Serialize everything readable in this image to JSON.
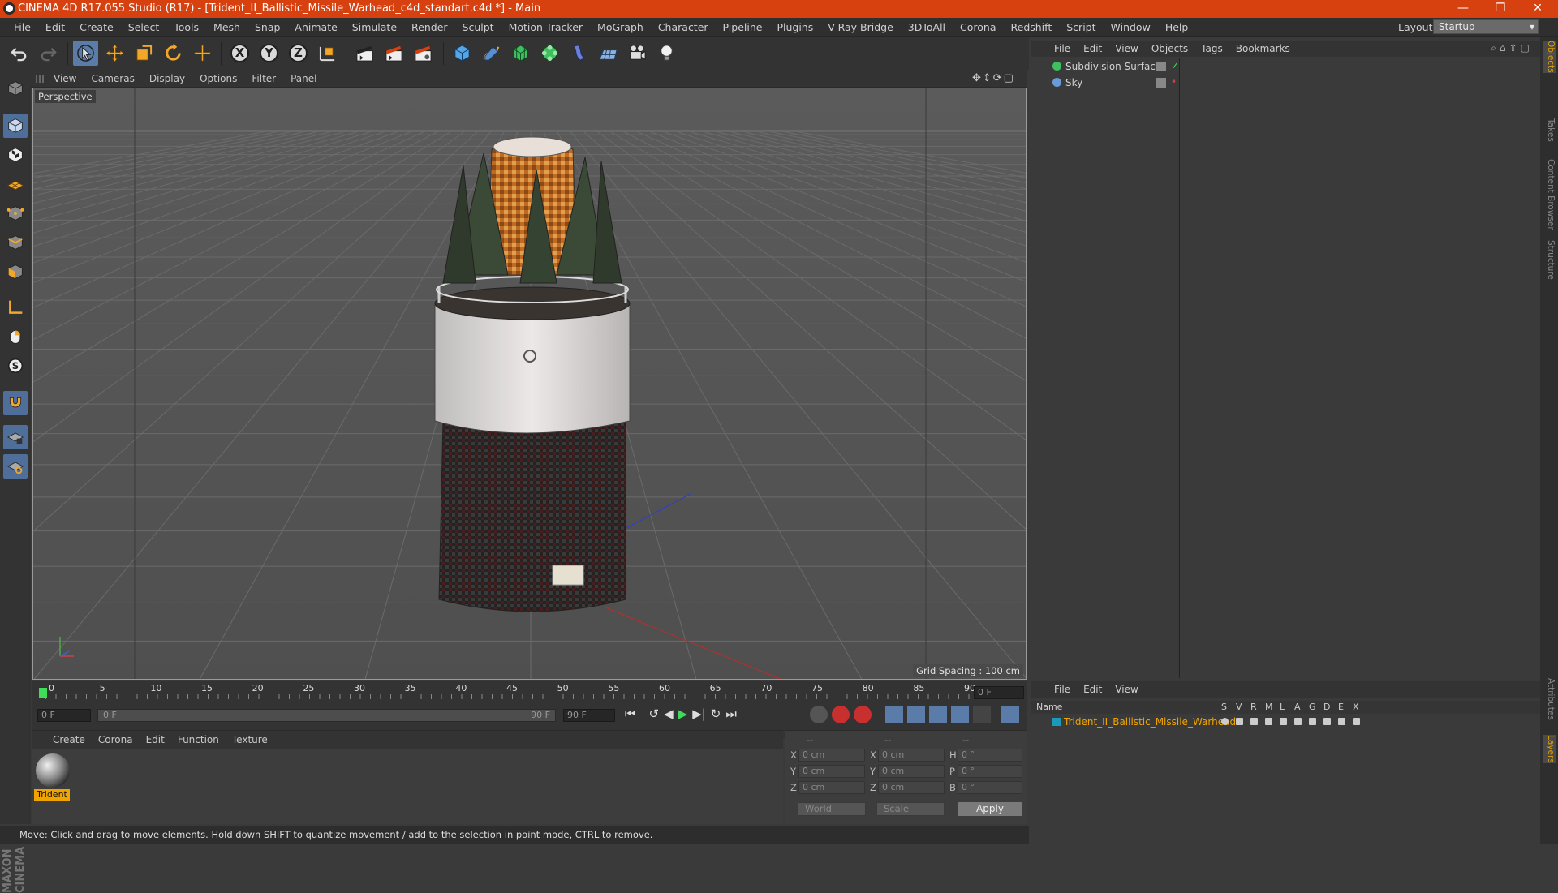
{
  "window": {
    "title": "CINEMA 4D R17.055 Studio (R17) - [Trident_II_Ballistic_Missile_Warhead_c4d_standart.c4d *] - Main",
    "minimize": "—",
    "maximize": "❐",
    "close": "✕"
  },
  "menubar": {
    "items": [
      "File",
      "Edit",
      "Create",
      "Select",
      "Tools",
      "Mesh",
      "Snap",
      "Animate",
      "Simulate",
      "Render",
      "Sculpt",
      "Motion Tracker",
      "MoGraph",
      "Character",
      "Pipeline",
      "Plugins",
      "V-Ray Bridge",
      "3DToAll",
      "Corona",
      "Redshift",
      "Script",
      "Window",
      "Help"
    ],
    "layout_label": "Layout:",
    "layout_value": "Startup"
  },
  "toolbar": {
    "undo": "undo-icon",
    "redo": "redo-icon",
    "axis": [
      "X",
      "Y",
      "Z"
    ]
  },
  "viewport": {
    "menu": [
      "View",
      "Cameras",
      "Display",
      "Options",
      "Filter",
      "Panel"
    ],
    "camera": "Perspective",
    "grid_spacing": "Grid Spacing : 100 cm"
  },
  "timeline": {
    "ticks": [
      "0",
      "5",
      "10",
      "15",
      "20",
      "25",
      "30",
      "35",
      "40",
      "45",
      "50",
      "55",
      "60",
      "65",
      "70",
      "75",
      "80",
      "85",
      "90"
    ],
    "current": "0 F",
    "start": "0 F",
    "range_start": "0 F",
    "range_end": "90 F",
    "end": "90 F"
  },
  "materials": {
    "menu": [
      "Create",
      "Corona",
      "Edit",
      "Function",
      "Texture"
    ],
    "items": [
      {
        "name": "Trident"
      }
    ]
  },
  "coordinates": {
    "header": [
      "--",
      "--",
      "--"
    ],
    "rows": [
      {
        "a": "X",
        "v1": "0 cm",
        "b": "X",
        "v2": "0 cm",
        "c": "H",
        "v3": "0 °"
      },
      {
        "a": "Y",
        "v1": "0 cm",
        "b": "Y",
        "v2": "0 cm",
        "c": "P",
        "v3": "0 °"
      },
      {
        "a": "Z",
        "v1": "0 cm",
        "b": "Z",
        "v2": "0 cm",
        "c": "B",
        "v3": "0 °"
      }
    ],
    "world": "World",
    "scale": "Scale",
    "apply": "Apply"
  },
  "objects": {
    "menu": [
      "File",
      "Edit",
      "View",
      "Objects",
      "Tags",
      "Bookmarks"
    ],
    "items": [
      {
        "name": "Subdivision Surface",
        "color": "#3fbf5f"
      },
      {
        "name": "Sky",
        "color": "#6a9ad8"
      }
    ]
  },
  "layers": {
    "menu": [
      "File",
      "Edit",
      "View"
    ],
    "columns": [
      "Name",
      "S",
      "V",
      "R",
      "M",
      "L",
      "A",
      "G",
      "D",
      "E",
      "X"
    ],
    "items": [
      {
        "name": "Trident_II_Ballistic_Missile_Warhead",
        "color": "#1a9ab8"
      }
    ]
  },
  "status": "Move: Click and drag to move elements. Hold down SHIFT to quantize movement / add to the selection in point mode, CTRL to remove.",
  "right_tabs": [
    "Objects",
    "Takes",
    "Content Browser",
    "Structure",
    "Attributes",
    "Layers"
  ],
  "brand": "MAXON CINEMA 4D",
  "colors": {
    "title_bar": "#d7410f",
    "selection": "#f0a400",
    "accent_blue": "#5b7ca8"
  }
}
